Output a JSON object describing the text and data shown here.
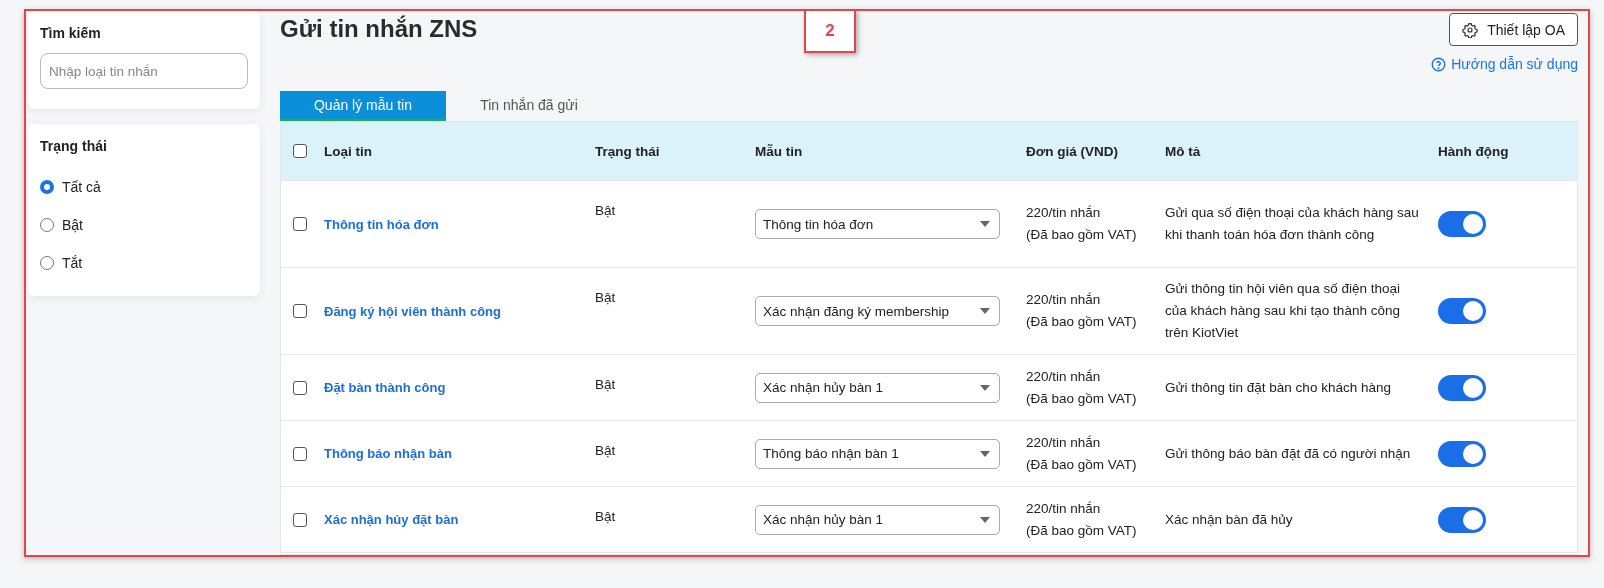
{
  "annotation": {
    "label": "2"
  },
  "sidebar": {
    "search": {
      "title": "Tìm kiếm",
      "placeholder": "Nhập loại tin nhắn"
    },
    "status_filter": {
      "title": "Trạng thái",
      "options": [
        {
          "label": "Tất cả",
          "selected": true
        },
        {
          "label": "Bật",
          "selected": false
        },
        {
          "label": "Tắt",
          "selected": false
        }
      ]
    }
  },
  "header": {
    "title": "Gửi tin nhắn ZNS",
    "settings_button": "Thiết lập OA",
    "help_link": "Hướng dẫn sử dụng"
  },
  "tabs": [
    {
      "label": "Quản lý mẫu tin",
      "selected": true
    },
    {
      "label": "Tin nhắn đã gửi",
      "selected": false
    }
  ],
  "table": {
    "select_all_checked": false,
    "columns": [
      "Loại tin",
      "Trạng thái",
      "Mẫu tin",
      "Đơn giá (VND)",
      "Mô tả",
      "Hành động"
    ],
    "rows": [
      {
        "checked": false,
        "name": "Thông tin hóa đơn",
        "status": "Bật",
        "template": "Thông tin hóa đơn",
        "price": "220/tin nhắn",
        "price_note": "(Đã bao gồm VAT)",
        "description": "Gửi qua số điện thoại của khách hàng sau khi thanh toán hóa đơn thành công",
        "on": true
      },
      {
        "checked": false,
        "name": "Đăng ký hội viên thành công",
        "status": "Bật",
        "template": "Xác nhận đăng ký membership",
        "price": "220/tin nhắn",
        "price_note": "(Đã bao gồm VAT)",
        "description": "Gửi thông tin hội viên qua số điện thoại của khách hàng sau khi tạo thành công trên KiotViet",
        "on": true
      },
      {
        "checked": false,
        "name": "Đặt bàn thành công",
        "status": "Bật",
        "template": "Xác nhận hủy bàn 1",
        "price": "220/tin nhắn",
        "price_note": "(Đã bao gồm VAT)",
        "description": "Gửi thông tin đặt bàn cho khách hàng",
        "on": true
      },
      {
        "checked": false,
        "name": "Thông báo nhận bàn",
        "status": "Bật",
        "template": "Thông báo nhận bàn 1",
        "price": "220/tin nhắn",
        "price_note": "(Đã bao gồm VAT)",
        "description": "Gửi thông báo bàn đặt đã có người nhận",
        "on": true
      },
      {
        "checked": false,
        "name": "Xác nhận hủy đặt bàn",
        "status": "Bật",
        "template": "Xác nhận hủy bàn 1",
        "price": "220/tin nhắn",
        "price_note": "(Đã bao gồm VAT)",
        "description": "Xác nhận bàn đã hủy",
        "on": true
      }
    ]
  }
}
